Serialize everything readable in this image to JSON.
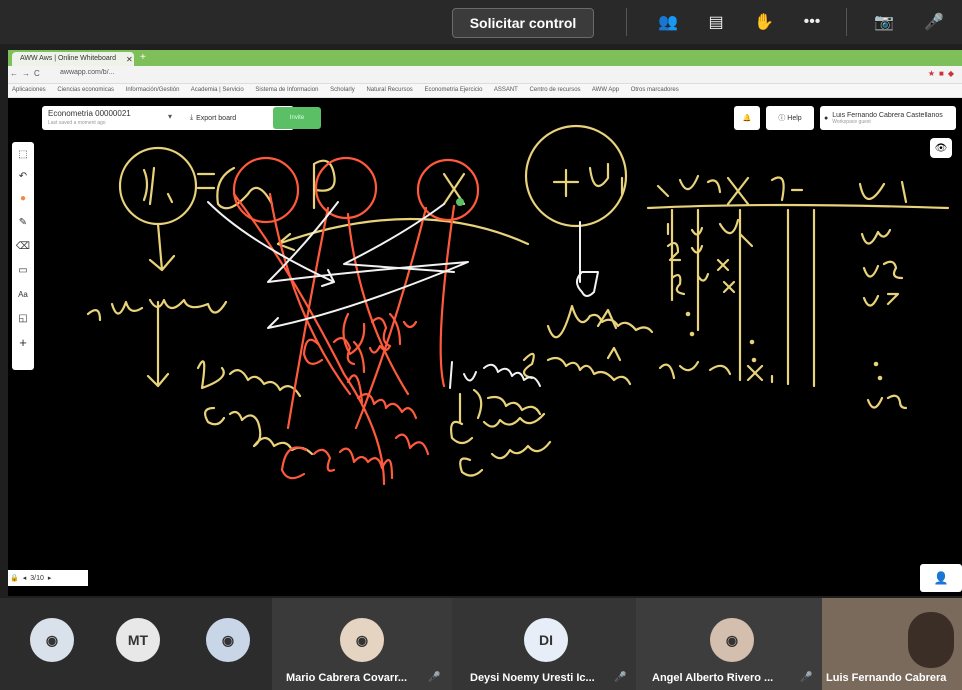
{
  "meeting": {
    "request_control_label": "Solicitar control",
    "toolbar_icons": [
      "participants-icon",
      "chat-icon",
      "raise-hand-icon",
      "more-icon",
      "camera-off-icon",
      "mic-off-icon"
    ]
  },
  "browser": {
    "tab_title": "AWW Aws | Online Whiteboard",
    "url": "awwapp.com/b/...",
    "bookmarks": [
      "Aplicaciones",
      "Ciencias economicas",
      "Información/Gestión",
      "Academia | Servicio",
      "Sistema de Informacion",
      "Scholarly",
      "Natural Recursos",
      "Econometria Ejercicio",
      "ASSANT",
      "Centro de recursos",
      "AWW App",
      "Otros marcadores"
    ]
  },
  "whiteboard": {
    "board_title": "Econometria 00000021",
    "board_subtitle": "Last saved a moment ago",
    "export_label": "Export board",
    "invite_label": "Invite",
    "help_label": "Help",
    "user_name": "Luis Fernando Cabrera Castellanos",
    "user_sub": "Workspace guest",
    "page_indicator": "3/10"
  },
  "participants": [
    {
      "name": "",
      "avatar_type": "photo",
      "avatar_color": "#d9e2ea"
    },
    {
      "name": "",
      "avatar_type": "initials",
      "initials": "MT",
      "avatar_color": "#e8e8e8"
    },
    {
      "name": "",
      "avatar_type": "photo",
      "avatar_color": "#c9d6e8"
    },
    {
      "name": "Mario Cabrera Covarr...",
      "avatar_type": "photo",
      "avatar_color": "#e6d4c3",
      "muted": true
    },
    {
      "name": "Deysi Noemy Uresti Ic...",
      "avatar_type": "initials",
      "initials": "DI",
      "avatar_color": "#e8eef7",
      "muted": true
    },
    {
      "name": "Angel Alberto Rivero ...",
      "avatar_type": "photo",
      "avatar_color": "#d4bfae",
      "muted": true
    },
    {
      "name": "Luis Fernando Cabrera",
      "avatar_type": "video",
      "avatar_color": "#7a6a5c",
      "muted": false
    }
  ],
  "colors": {
    "meeting_bg": "#292929",
    "tabstrip_green": "#7fbf5a",
    "invite_green": "#5bbf65",
    "ink_yellow": "#e8d27a",
    "ink_red": "#ff5a3c",
    "ink_white": "#f2f2f2"
  }
}
